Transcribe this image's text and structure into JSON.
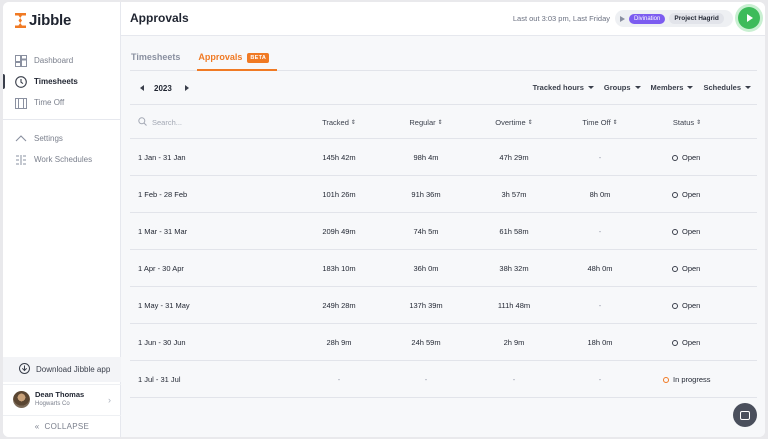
{
  "app": {
    "name": "Jibble"
  },
  "sidebar": {
    "items": [
      {
        "label": "Dashboard",
        "icon": "dashboard-icon"
      },
      {
        "label": "Timesheets",
        "icon": "clock-icon",
        "active": true
      },
      {
        "label": "Time Off",
        "icon": "calendar-icon"
      },
      {
        "label": "Settings",
        "icon": "settings-icon"
      },
      {
        "label": "Work Schedules",
        "icon": "schedule-icon"
      }
    ],
    "download_label": "Download Jibble app",
    "user": {
      "name": "Dean Thomas",
      "org": "Hogwarts Co"
    },
    "collapse_label": "COLLAPSE"
  },
  "header": {
    "title": "Approvals",
    "last_out": "Last out 3:03 pm, Last Friday",
    "activity": "Divination",
    "project": "Project Hagrid"
  },
  "tabs": [
    {
      "label": "Timesheets"
    },
    {
      "label": "Approvals",
      "badge": "BETA",
      "active": true
    }
  ],
  "toolbar": {
    "year": "2023",
    "filters": [
      "Tracked hours",
      "Groups",
      "Members",
      "Schedules"
    ]
  },
  "table": {
    "search_placeholder": "Search...",
    "columns": [
      "Tracked",
      "Regular",
      "Overtime",
      "Time Off",
      "Status"
    ],
    "rows": [
      {
        "period": "1 Jan - 31 Jan",
        "tracked": "145h 42m",
        "regular": "98h 4m",
        "overtime": "47h 29m",
        "time_off": "-",
        "status": "Open"
      },
      {
        "period": "1 Feb - 28 Feb",
        "tracked": "101h 26m",
        "regular": "91h 36m",
        "overtime": "3h 57m",
        "time_off": "8h 0m",
        "status": "Open"
      },
      {
        "period": "1 Mar - 31 Mar",
        "tracked": "209h 49m",
        "regular": "74h 5m",
        "overtime": "61h 58m",
        "time_off": "-",
        "status": "Open"
      },
      {
        "period": "1 Apr - 30 Apr",
        "tracked": "183h 10m",
        "regular": "36h 0m",
        "overtime": "38h 32m",
        "time_off": "48h 0m",
        "status": "Open"
      },
      {
        "period": "1 May - 31 May",
        "tracked": "249h 28m",
        "regular": "137h 39m",
        "overtime": "111h 48m",
        "time_off": "-",
        "status": "Open"
      },
      {
        "period": "1 Jun - 30 Jun",
        "tracked": "28h 9m",
        "regular": "24h 59m",
        "overtime": "2h 9m",
        "time_off": "18h 0m",
        "status": "Open"
      },
      {
        "period": "1 Jul - 31 Jul",
        "tracked": "-",
        "regular": "-",
        "overtime": "-",
        "time_off": "-",
        "status": "In progress"
      }
    ]
  },
  "colors": {
    "accent": "#f07a24",
    "play": "#3dbb5a",
    "activity": "#7c5cf0"
  }
}
